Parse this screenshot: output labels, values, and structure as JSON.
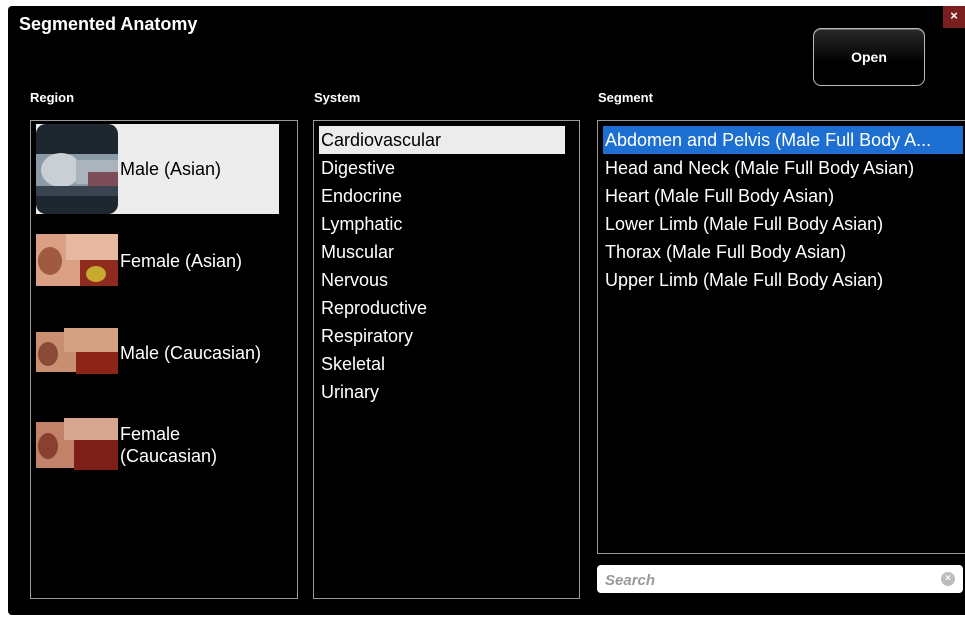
{
  "window": {
    "title": "Segmented Anatomy",
    "close_label": "×"
  },
  "toolbar": {
    "open_label": "Open"
  },
  "columns": {
    "region": "Region",
    "system": "System",
    "segment": "Segment"
  },
  "regions": [
    {
      "label": "Male (Asian)",
      "selected": true
    },
    {
      "label": "Female (Asian)",
      "selected": false
    },
    {
      "label": "Male (Caucasian)",
      "selected": false
    },
    {
      "label": "Female (Caucasian)",
      "selected": false
    }
  ],
  "systems": [
    {
      "label": "Cardiovascular",
      "selected": true
    },
    {
      "label": "Digestive"
    },
    {
      "label": "Endocrine"
    },
    {
      "label": "Lymphatic"
    },
    {
      "label": "Muscular"
    },
    {
      "label": "Nervous"
    },
    {
      "label": "Reproductive"
    },
    {
      "label": "Respiratory"
    },
    {
      "label": "Skeletal"
    },
    {
      "label": "Urinary"
    }
  ],
  "segments": [
    {
      "label": "Abdomen and Pelvis (Male Full Body A...",
      "selected": true
    },
    {
      "label": "Head and Neck (Male Full Body Asian)"
    },
    {
      "label": "Heart (Male Full Body Asian)"
    },
    {
      "label": "Lower Limb (Male Full Body Asian)"
    },
    {
      "label": "Thorax (Male Full Body Asian)"
    },
    {
      "label": "Upper Limb (Male Full Body Asian)"
    }
  ],
  "search": {
    "placeholder": "Search",
    "value": ""
  },
  "colors": {
    "selected_segment": "#1d6fd1",
    "selected_light": "#ececec",
    "close": "#7a1f1f"
  }
}
